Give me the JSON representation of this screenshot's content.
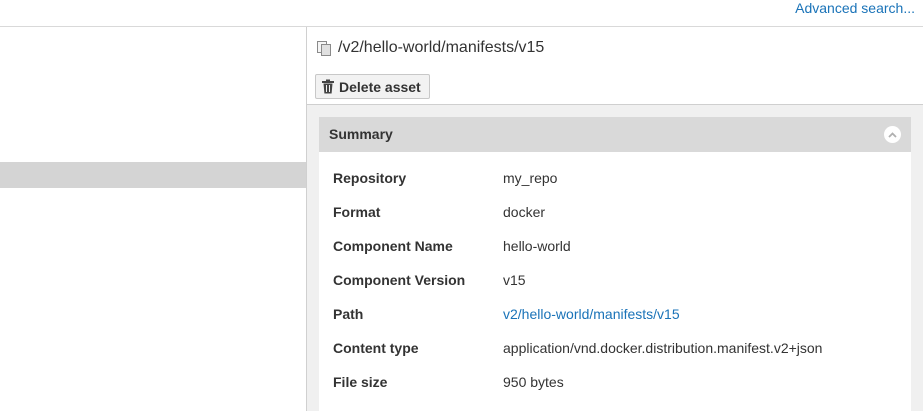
{
  "topbar": {
    "advanced_search": "Advanced search..."
  },
  "asset": {
    "title": "/v2/hello-world/manifests/v15",
    "title_icon": "copy-icon",
    "delete_label": "Delete asset",
    "delete_icon": "trash-icon"
  },
  "summary": {
    "title": "Summary",
    "collapse_icon": "chevron-up-icon",
    "rows": [
      {
        "label": "Repository",
        "value": "my_repo"
      },
      {
        "label": "Format",
        "value": "docker"
      },
      {
        "label": "Component Name",
        "value": "hello-world"
      },
      {
        "label": "Component Version",
        "value": "v15"
      },
      {
        "label": "Path",
        "value": "v2/hello-world/manifests/v15"
      },
      {
        "label": "Content type",
        "value": "application/vnd.docker.distribution.manifest.v2+json"
      },
      {
        "label": "File size",
        "value": "950 bytes"
      }
    ]
  },
  "colors": {
    "link": "#1a73b8",
    "header_bg": "#d9d9d9",
    "selected_row": "#d4d4d4"
  }
}
